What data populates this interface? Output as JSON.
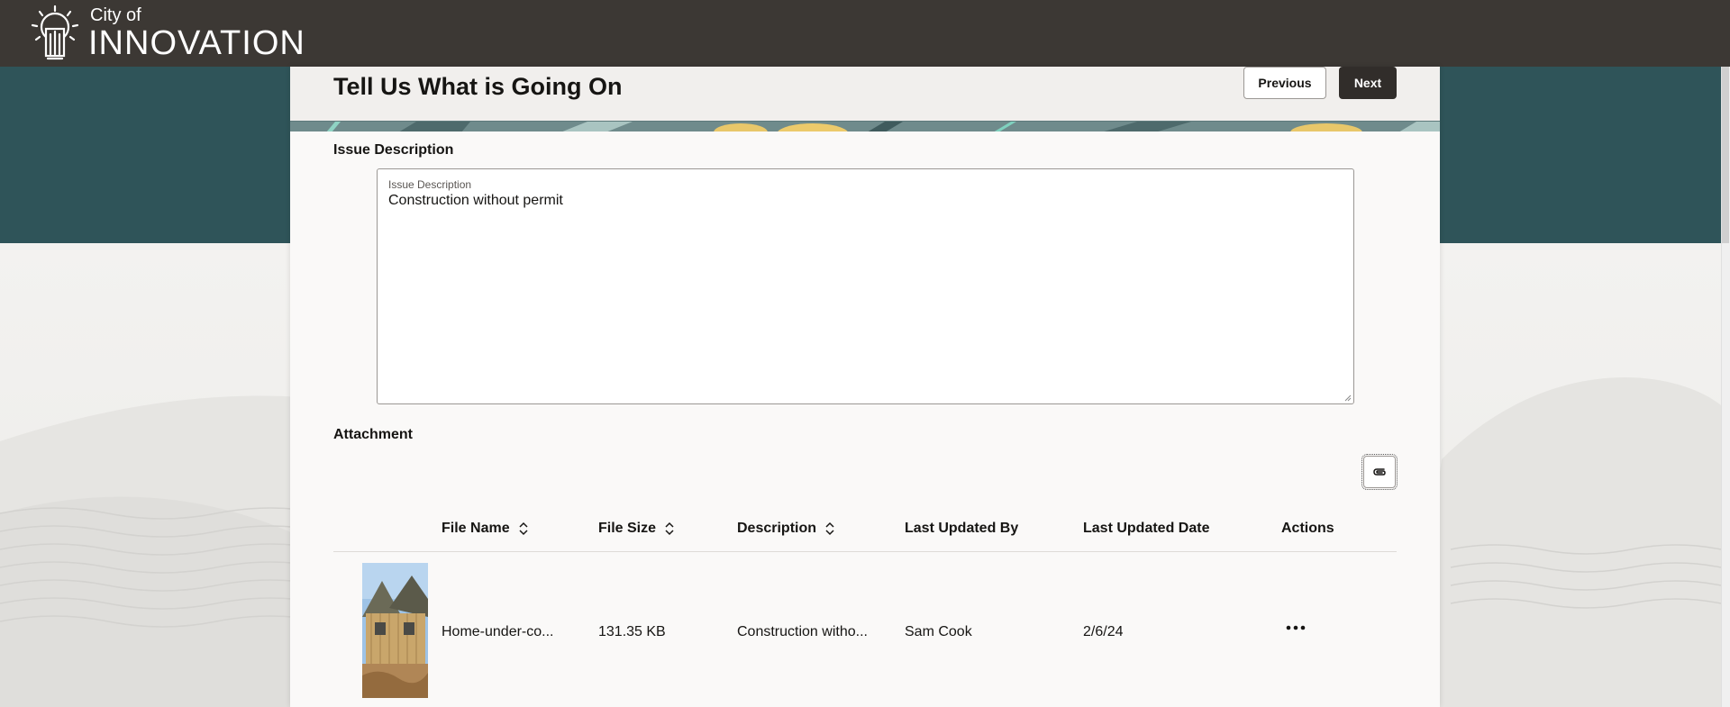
{
  "header": {
    "logo_small": "City of",
    "logo_big": "INNOVATION"
  },
  "page": {
    "title": "Tell Us What is Going On",
    "previous_label": "Previous",
    "next_label": "Next"
  },
  "issue": {
    "section_label": "Issue Description",
    "field_label": "Issue Description",
    "value": "Construction without permit"
  },
  "attachment": {
    "section_label": "Attachment",
    "columns": [
      "File Name",
      "File Size",
      "Description",
      "Last Updated By",
      "Last Updated Date",
      "Actions"
    ],
    "rows": [
      {
        "file_name": "Home-under-co...",
        "file_size": "131.35 KB",
        "description": "Construction witho...",
        "last_updated_by": "Sam Cook",
        "last_updated_date": "2/6/24"
      }
    ]
  },
  "colors": {
    "topbar": "#3c3834",
    "teal": "#2f5459",
    "primary_button": "#312d2a"
  },
  "icons": [
    "lightbulb-logo-icon",
    "paperclip-icon",
    "sort-icon",
    "more-actions-icon"
  ]
}
